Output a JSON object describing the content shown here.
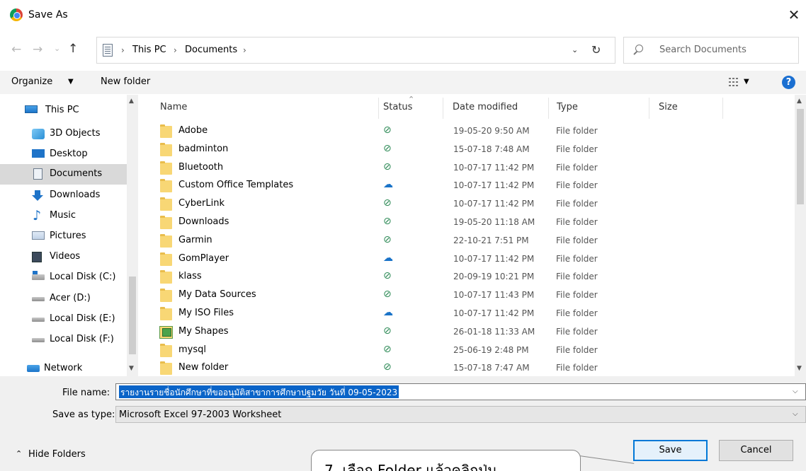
{
  "window": {
    "title": "Save As",
    "close_glyph": "✕"
  },
  "address": {
    "crumbs": [
      "This PC",
      "Documents"
    ],
    "search_placeholder": "Search Documents"
  },
  "toolbar": {
    "organize": "Organize",
    "new_folder": "New folder"
  },
  "nav": {
    "items": [
      {
        "label": "This PC",
        "icon": "pc-icon"
      },
      {
        "label": "3D Objects",
        "icon": "3d-objects-icon"
      },
      {
        "label": "Desktop",
        "icon": "desktop-icon"
      },
      {
        "label": "Documents",
        "icon": "documents-icon",
        "selected": true
      },
      {
        "label": "Downloads",
        "icon": "downloads-icon"
      },
      {
        "label": "Music",
        "icon": "music-icon"
      },
      {
        "label": "Pictures",
        "icon": "pictures-icon"
      },
      {
        "label": "Videos",
        "icon": "videos-icon"
      },
      {
        "label": "Local Disk (C:)",
        "icon": "local-disk-c-icon"
      },
      {
        "label": "Acer (D:)",
        "icon": "drive-icon"
      },
      {
        "label": "Local Disk (E:)",
        "icon": "drive-icon"
      },
      {
        "label": "Local Disk (F:)",
        "icon": "drive-icon"
      },
      {
        "label": "Network",
        "icon": "network-icon"
      }
    ]
  },
  "columns": {
    "name": "Name",
    "status": "Status",
    "date": "Date modified",
    "type": "Type",
    "size": "Size"
  },
  "files": [
    {
      "name": "Adobe",
      "status": "synced",
      "date": "19-05-20 9:50 AM",
      "type": "File folder"
    },
    {
      "name": "badminton",
      "status": "synced",
      "date": "15-07-18 7:48 AM",
      "type": "File folder"
    },
    {
      "name": "Bluetooth",
      "status": "synced",
      "date": "10-07-17 11:42 PM",
      "type": "File folder"
    },
    {
      "name": "Custom Office Templates",
      "status": "cloud",
      "date": "10-07-17 11:42 PM",
      "type": "File folder"
    },
    {
      "name": "CyberLink",
      "status": "synced",
      "date": "10-07-17 11:42 PM",
      "type": "File folder"
    },
    {
      "name": "Downloads",
      "status": "synced",
      "date": "19-05-20 11:18 AM",
      "type": "File folder"
    },
    {
      "name": "Garmin",
      "status": "synced",
      "date": "22-10-21 7:51 PM",
      "type": "File folder"
    },
    {
      "name": "GomPlayer",
      "status": "cloud",
      "date": "10-07-17 11:42 PM",
      "type": "File folder"
    },
    {
      "name": "klass",
      "status": "synced",
      "date": "20-09-19 10:21 PM",
      "type": "File folder"
    },
    {
      "name": "My Data Sources",
      "status": "synced",
      "date": "10-07-17 11:43 PM",
      "type": "File folder"
    },
    {
      "name": "My ISO Files",
      "status": "cloud",
      "date": "10-07-17 11:42 PM",
      "type": "File folder"
    },
    {
      "name": "My Shapes",
      "status": "synced",
      "date": "26-01-18 11:33 AM",
      "type": "File folder",
      "special_icon": true
    },
    {
      "name": "mysql",
      "status": "synced",
      "date": "25-06-19 2:48 PM",
      "type": "File folder"
    },
    {
      "name": "New folder",
      "status": "synced",
      "date": "15-07-18 7:47 AM",
      "type": "File folder"
    }
  ],
  "status_glyphs": {
    "synced": "⊘",
    "cloud": "☁"
  },
  "bottom": {
    "filename_label": "File name:",
    "filename_value": "รายงานรายชื่อนักศึกษาที่ขออนุมัติสาขาการศึกษาปฐมวัย วันที่ 09-05-2023",
    "savetype_label": "Save as type:",
    "savetype_value": "Microsoft Excel 97-2003 Worksheet",
    "hide_folders": "Hide Folders",
    "save": "Save",
    "cancel": "Cancel"
  },
  "callout": {
    "text": "7. เลือก Folder แล้วคลิกปุ่ม"
  },
  "colors": {
    "accent": "#0078d7",
    "selection": "#0a64c8",
    "folder": "#f8d775"
  }
}
